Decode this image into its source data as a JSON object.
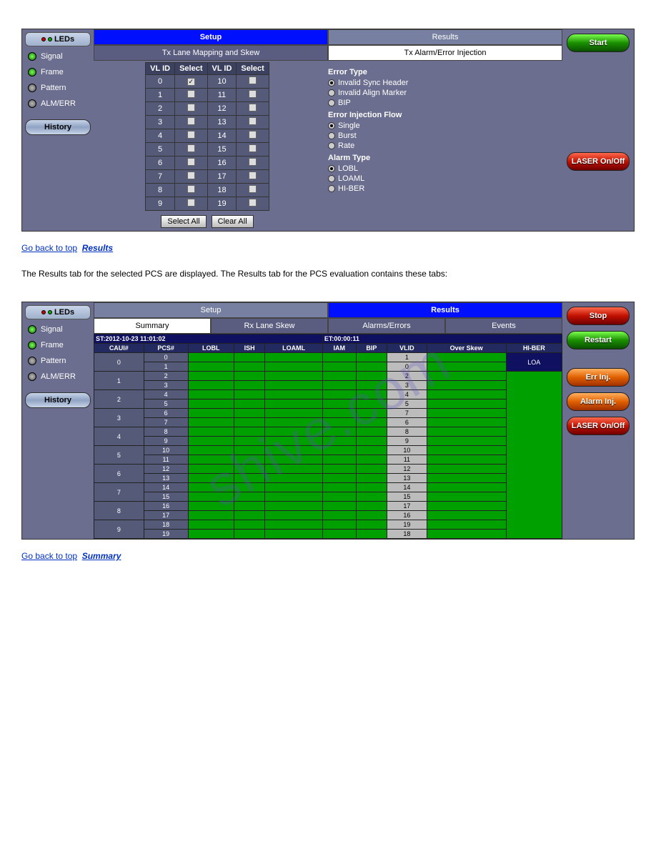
{
  "watermark": "shive.com",
  "panel1": {
    "leds": {
      "header": "LEDs",
      "items": [
        {
          "label": "Signal",
          "color": "green"
        },
        {
          "label": "Frame",
          "color": "green"
        },
        {
          "label": "Pattern",
          "color": "gray"
        },
        {
          "label": "ALM/ERR",
          "color": "gray"
        }
      ],
      "history": "History"
    },
    "tabs": {
      "setup": "Setup",
      "results": "Results"
    },
    "subtabs": {
      "mapping": "Tx Lane Mapping and Skew",
      "alarm": "Tx Alarm/Error Injection"
    },
    "lane": {
      "headers": [
        "VL ID",
        "Select",
        "VL ID",
        "Select"
      ],
      "rows": [
        [
          "0",
          true,
          "10",
          false
        ],
        [
          "1",
          false,
          "11",
          false
        ],
        [
          "2",
          false,
          "12",
          false
        ],
        [
          "3",
          false,
          "13",
          false
        ],
        [
          "4",
          false,
          "14",
          false
        ],
        [
          "5",
          false,
          "15",
          false
        ],
        [
          "6",
          false,
          "16",
          false
        ],
        [
          "7",
          false,
          "17",
          false
        ],
        [
          "8",
          false,
          "18",
          false
        ],
        [
          "9",
          false,
          "19",
          false
        ]
      ],
      "select_all": "Select All",
      "clear_all": "Clear All"
    },
    "error_type": {
      "title": "Error Type",
      "opts": [
        "Invalid Sync Header",
        "Invalid Align Marker",
        "BIP"
      ],
      "sel": 0
    },
    "injection_flow": {
      "title": "Error Injection Flow",
      "opts": [
        "Single",
        "Burst",
        "Rate"
      ],
      "sel": 0
    },
    "alarm_type": {
      "title": "Alarm Type",
      "opts": [
        "LOBL",
        "LOAML",
        "HI-BER"
      ],
      "sel": 0
    },
    "right": {
      "start": "Start",
      "laser": "LASER On/Off"
    }
  },
  "desc1": {
    "head": "Go back to top",
    "link": "Results",
    "text": "The Results tab for the selected PCS are displayed. The Results tab for the PCS evaluation contains these tabs:"
  },
  "panel2": {
    "leds": {
      "header": "LEDs",
      "items": [
        {
          "label": "Signal",
          "color": "green"
        },
        {
          "label": "Frame",
          "color": "green"
        },
        {
          "label": "Pattern",
          "color": "gray"
        },
        {
          "label": "ALM/ERR",
          "color": "gray"
        }
      ],
      "history": "History"
    },
    "tabs": {
      "setup": "Setup",
      "results": "Results"
    },
    "subtabs": [
      "Summary",
      "Rx Lane Skew",
      "Alarms/Errors",
      "Events"
    ],
    "timebar": {
      "st": "ST:2012-10-23 11:01:02",
      "et": "ET:00:00:11"
    },
    "headers": [
      "CAUI#",
      "PCS#",
      "LOBL",
      "ISH",
      "LOAML",
      "IAM",
      "BIP",
      "VLID",
      "Over Skew",
      "HI-BER"
    ],
    "loa": "LOA",
    "caui": [
      "0",
      "1",
      "2",
      "3",
      "4",
      "5",
      "6",
      "7",
      "8",
      "9"
    ],
    "pcs": [
      "0",
      "1",
      "2",
      "3",
      "4",
      "5",
      "6",
      "7",
      "8",
      "9",
      "10",
      "11",
      "12",
      "13",
      "14",
      "15",
      "16",
      "17",
      "18",
      "19"
    ],
    "vlid": [
      "1",
      "0",
      "2",
      "3",
      "4",
      "5",
      "7",
      "6",
      "8",
      "9",
      "10",
      "11",
      "12",
      "13",
      "14",
      "15",
      "17",
      "16",
      "19",
      "18"
    ],
    "right": {
      "stop": "Stop",
      "restart": "Restart",
      "err": "Err Inj.",
      "alarm": "Alarm Inj.",
      "laser": "LASER On/Off"
    }
  },
  "desc2": {
    "head": "Go back to top",
    "link": "Summary"
  }
}
